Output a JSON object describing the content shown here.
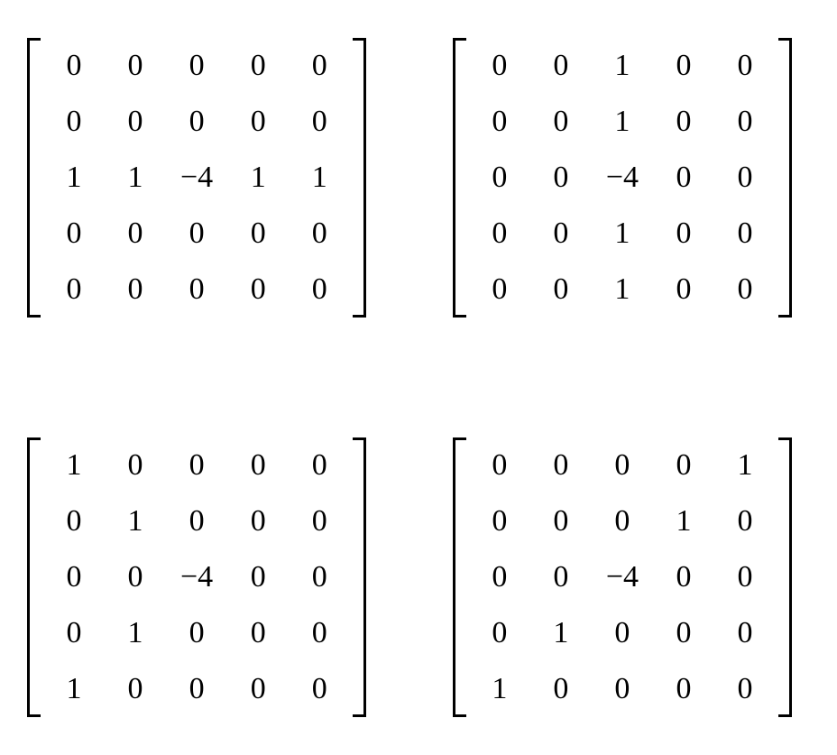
{
  "matrices": [
    {
      "name": "matrix-top-left",
      "rows": [
        [
          "0",
          "0",
          "0",
          "0",
          "0"
        ],
        [
          "0",
          "0",
          "0",
          "0",
          "0"
        ],
        [
          "1",
          "1",
          "−4",
          "1",
          "1"
        ],
        [
          "0",
          "0",
          "0",
          "0",
          "0"
        ],
        [
          "0",
          "0",
          "0",
          "0",
          "0"
        ]
      ]
    },
    {
      "name": "matrix-top-right",
      "rows": [
        [
          "0",
          "0",
          "1",
          "0",
          "0"
        ],
        [
          "0",
          "0",
          "1",
          "0",
          "0"
        ],
        [
          "0",
          "0",
          "−4",
          "0",
          "0"
        ],
        [
          "0",
          "0",
          "1",
          "0",
          "0"
        ],
        [
          "0",
          "0",
          "1",
          "0",
          "0"
        ]
      ]
    },
    {
      "name": "matrix-bottom-left",
      "rows": [
        [
          "1",
          "0",
          "0",
          "0",
          "0"
        ],
        [
          "0",
          "1",
          "0",
          "0",
          "0"
        ],
        [
          "0",
          "0",
          "−4",
          "0",
          "0"
        ],
        [
          "0",
          "1",
          "0",
          "0",
          "0"
        ],
        [
          "1",
          "0",
          "0",
          "0",
          "0"
        ]
      ]
    },
    {
      "name": "matrix-bottom-right",
      "rows": [
        [
          "0",
          "0",
          "0",
          "0",
          "1"
        ],
        [
          "0",
          "0",
          "0",
          "1",
          "0"
        ],
        [
          "0",
          "0",
          "−4",
          "0",
          "0"
        ],
        [
          "0",
          "1",
          "0",
          "0",
          "0"
        ],
        [
          "1",
          "0",
          "0",
          "0",
          "0"
        ]
      ]
    }
  ]
}
